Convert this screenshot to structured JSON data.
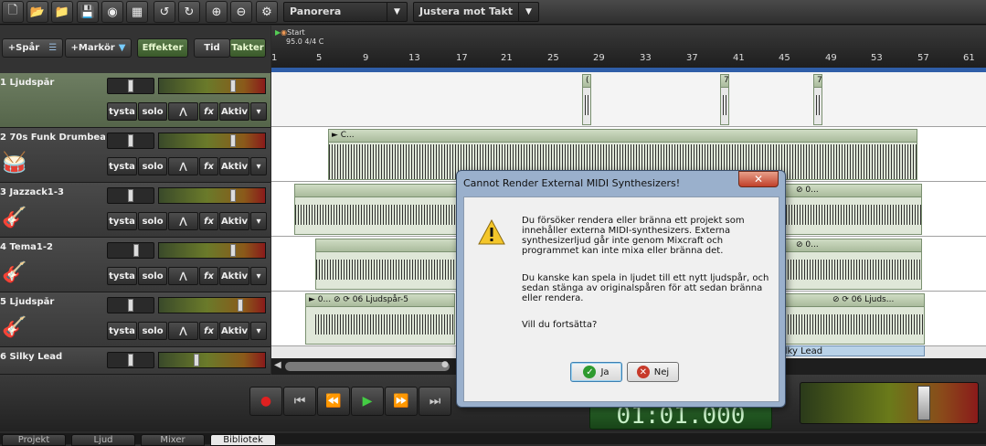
{
  "toolbar": {
    "icons": [
      "new-file-icon",
      "open-folder-icon",
      "open-folder-alt-icon",
      "save-icon",
      "cd-icon",
      "video-icon",
      "undo-icon",
      "redo-icon",
      "zoom-in-icon",
      "zoom-out-icon",
      "gear-icon"
    ],
    "pan_dropdown": "Panorera",
    "snap_dropdown": "Justera mot Takt"
  },
  "left_controls": {
    "add_track": "+Spår",
    "add_marker": "+Markör",
    "effects": "Effekter",
    "time": "Tid",
    "bars": "Takter"
  },
  "tracks": [
    {
      "name": "1 Ljudspår",
      "selected": true
    },
    {
      "name": "2 70s Funk Drumbea...",
      "instrument": "drum-icon"
    },
    {
      "name": "3 Jazzack1-3",
      "instrument": "guitar-icon"
    },
    {
      "name": "4 Tema1-2",
      "instrument": "guitar-icon"
    },
    {
      "name": "5 Ljudspår",
      "instrument": "electric-guitar-icon"
    },
    {
      "name": "6 Silky Lead",
      "instrument": "keyboard-icon"
    }
  ],
  "track_buttons": {
    "mute": "tysta",
    "solo": "solo",
    "fx": "fx",
    "active": "Aktiv",
    "menu": "▾"
  },
  "ruler": {
    "start_label": "Start",
    "tempo": "95.0 4/4 C",
    "bars": [
      "1",
      "5",
      "9",
      "13",
      "17",
      "21",
      "25",
      "29",
      "33",
      "37",
      "41",
      "45",
      "49",
      "53",
      "57",
      "61"
    ]
  },
  "clips": {
    "track5_clip_a": "► 0... ⊘ ⟳ 06 Ljudspår-5",
    "track5_clip_b": "⊘ ⟳ 06 Ljuds...",
    "track3_clip_label": "⊘ 0...",
    "track4_clip_label": "⊘ 0...",
    "track2_clip_label": "► C...",
    "silky_clip": "ilky Lead"
  },
  "transport": {
    "time": "01:01.000"
  },
  "bottom_tabs": [
    "Projekt",
    "Ljud",
    "Mixer",
    "Bibliotek"
  ],
  "dialog": {
    "title": "Cannot Render External MIDI Synthesizers!",
    "close": "✕",
    "para1": "Du försöker rendera eller bränna ett projekt som innehåller externa MIDI-synthesizers.  Externa synthesizerljud går inte genom Mixcraft och programmet kan inte mixa eller bränna det.",
    "para2": "Du kanske kan spela in ljudet till ett nytt ljudspår, och sedan stänga av originalspåren för att sedan bränna eller rendera.",
    "para3": "Vill du fortsätta?",
    "yes": "Ja",
    "no": "Nej"
  }
}
